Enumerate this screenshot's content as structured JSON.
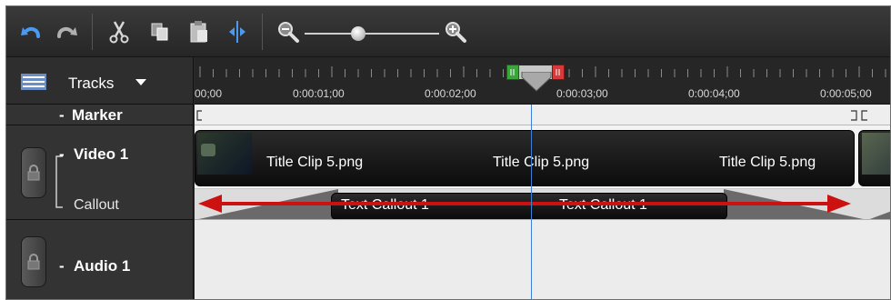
{
  "toolbar": {
    "undo_icon": "undo-icon",
    "redo_icon": "redo-icon",
    "cut_icon": "scissors-icon",
    "copy_icon": "copy-icon",
    "paste_icon": "paste-icon",
    "split_icon": "split-icon",
    "zoom_out_icon": "zoom-out-icon",
    "zoom_in_icon": "zoom-in-icon",
    "zoom_level": 0.4
  },
  "tracks_header": {
    "label": "Tracks",
    "icon": "tracks-icon"
  },
  "ruler": {
    "time_labels": [
      "00;00",
      "0:00:01;00",
      "0:00:02;00",
      "0:00:03;00",
      "0:00:04;00",
      "0:00:05;00"
    ]
  },
  "tracks": {
    "marker": {
      "name": "Marker",
      "toggle": "-"
    },
    "video1": {
      "name": "Video 1",
      "toggle": "-",
      "sub_track": "Callout",
      "clips": [
        "Title Clip 5.png",
        "Title Clip 5.png",
        "Title Clip 5.png"
      ],
      "callouts": [
        "Text Callout 1",
        "Text Callout 1"
      ]
    },
    "audio1": {
      "name": "Audio 1",
      "toggle": "-"
    }
  },
  "colors": {
    "playhead": "#3e7fd8",
    "annotation_arrow": "#cc1111",
    "selection_in": "#3aa53a",
    "selection_out": "#d83a3a"
  }
}
